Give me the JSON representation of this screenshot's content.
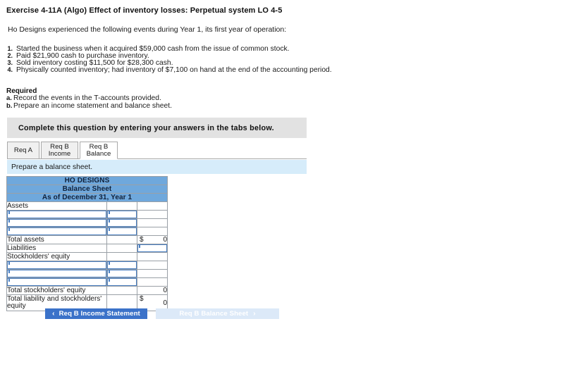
{
  "exercise": {
    "title": "Exercise 4-11A (Algo) Effect of inventory losses: Perpetual system LO 4-5",
    "intro": "Ho Designs experienced the following events during Year 1, its first year of operation:",
    "events": [
      {
        "num": "1.",
        "text": "Started the business when it acquired $59,000 cash from the issue of common stock."
      },
      {
        "num": "2.",
        "text": "Paid $21,900 cash to purchase inventory."
      },
      {
        "num": "3.",
        "text": "Sold inventory costing $11,500 for $28,300 cash."
      },
      {
        "num": "4.",
        "text": "Physically counted inventory; had inventory of $7,100 on hand at the end of the accounting period."
      }
    ],
    "required_label": "Required",
    "requirements": [
      {
        "letter": "a.",
        "text": "Record the events in the T-accounts provided."
      },
      {
        "letter": "b.",
        "text": "Prepare an income statement and balance sheet."
      }
    ]
  },
  "banner": {
    "text": "Complete this question by entering your answers in the tabs below."
  },
  "tabs": [
    {
      "id": "req-a",
      "line1": "Req A",
      "line2": "",
      "active": false
    },
    {
      "id": "req-b-income",
      "line1": "Req B",
      "line2": "Income",
      "active": false
    },
    {
      "id": "req-b-balance",
      "line1": "Req B",
      "line2": "Balance",
      "active": true
    }
  ],
  "subbar": {
    "text": "Prepare a balance sheet."
  },
  "balance_sheet": {
    "header_lines": [
      "HO DESIGNS",
      "Balance Sheet",
      "As of December 31, Year 1"
    ],
    "rows": [
      {
        "type": "label",
        "label": "Assets",
        "b": "",
        "c": ""
      },
      {
        "type": "input",
        "label": "",
        "b": "input",
        "c": ""
      },
      {
        "type": "input",
        "label": "",
        "b": "input",
        "c": ""
      },
      {
        "type": "input",
        "label": "",
        "b": "input",
        "c": ""
      },
      {
        "type": "total",
        "label": "Total assets",
        "b": "",
        "c": "0",
        "dollar": "$",
        "topline": true
      },
      {
        "type": "label",
        "label": "Liabilities",
        "b": "",
        "c": "input"
      },
      {
        "type": "label",
        "label": "Stockholders' equity",
        "b": "",
        "c": ""
      },
      {
        "type": "input",
        "label": "",
        "b": "input",
        "c": ""
      },
      {
        "type": "input",
        "label": "",
        "b": "input",
        "c": ""
      },
      {
        "type": "input",
        "label": "",
        "b": "input",
        "c": ""
      },
      {
        "type": "total",
        "label": "Total stockholders' equity",
        "b": "",
        "c": "0",
        "dollar": "",
        "topline": true
      },
      {
        "type": "total",
        "label": "Total liability and stockholders' equity",
        "b": "",
        "c": "0",
        "dollar": "$",
        "topline": false,
        "wrap": true
      }
    ]
  },
  "nav": {
    "prev": {
      "label": "Req B Income Statement",
      "chevron": "‹",
      "enabled": true
    },
    "next": {
      "label": "Req B Balance Sheet",
      "chevron": "›",
      "enabled": false
    }
  },
  "colors": {
    "table_header_blue": "#6fa8dc",
    "banner_grey": "#e2e2e2",
    "subbar_blue": "#d6ecfa",
    "button_blue": "#3b72c9",
    "button_disabled": "#dce9f8",
    "input_border": "#4a7fc1"
  }
}
